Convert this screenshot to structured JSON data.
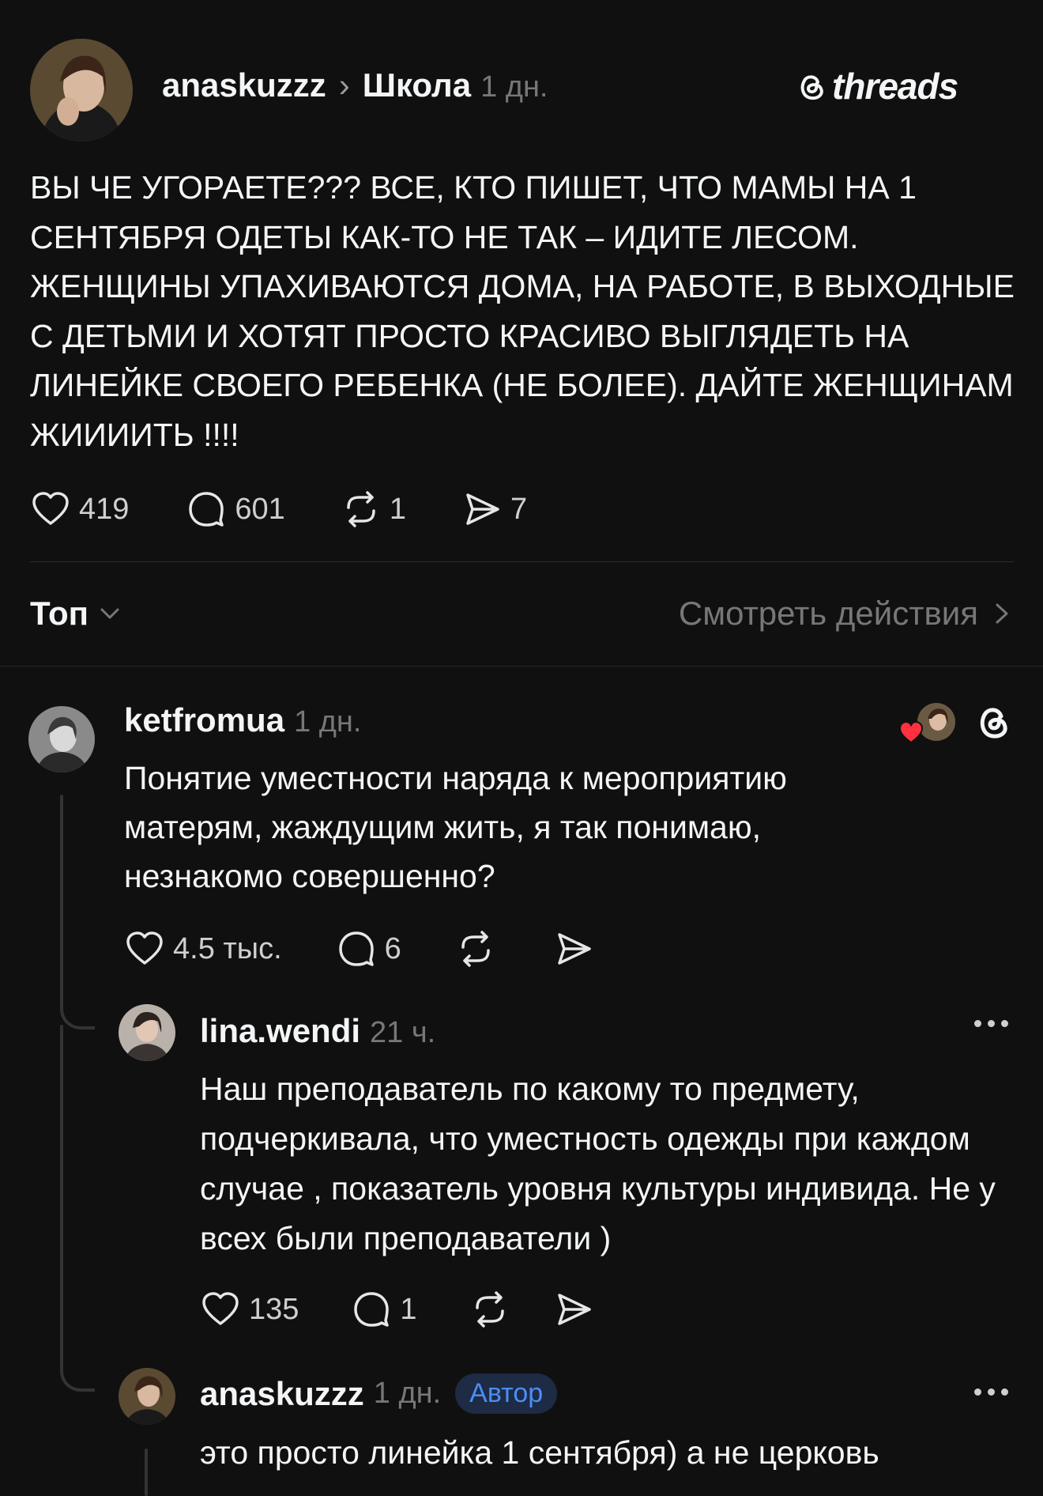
{
  "post": {
    "author": "anaskuzzz",
    "chevron": "›",
    "community": "Школа",
    "time": "1 дн.",
    "brand": "threads",
    "text": "ВЫ ЧЕ УГОРАЕТЕ??? ВСЕ, КТО ПИШЕТ, ЧТО МАМЫ НА 1 СЕНТЯБРЯ ОДЕТЫ КАК-ТО НЕ ТАК – ИДИТЕ ЛЕСОМ. ЖЕНЩИНЫ УПАХИВАЮТСЯ ДОМА, НА РАБОТЕ, В ВЫХОДНЫЕ С ДЕТЬМИ И ХОТЯТ ПРОСТО КРАСИВО ВЫГЛЯДЕТЬ НА ЛИНЕЙКЕ СВОЕГО РЕБЕНКА (НЕ БОЛЕЕ). ДАЙТЕ ЖЕНЩИНАМ ЖИИИИТЬ !!!!",
    "likes": "419",
    "replies": "601",
    "reposts": "1",
    "shares": "7"
  },
  "sort": {
    "label": "Топ",
    "activity_link": "Смотреть действия"
  },
  "comments": [
    {
      "author": "ketfromua",
      "time": "1 дн.",
      "text": "Понятие уместности наряда к мероприятию матерям, жаждущим жить, я так понимаю, незнакомо совершенно?",
      "likes": "4.5 тыс.",
      "replies": "6"
    },
    {
      "author": "lina.wendi",
      "time": "21 ч.",
      "text": "Наш преподаватель по какому то предмету, подчеркивала, что уместность одежды при каждом случае , показатель уровня культуры индивида. Не у всех были преподаватели )",
      "likes": "135",
      "replies": "1"
    },
    {
      "author": "anaskuzzz",
      "time": "1 дн.",
      "badge": "Автор",
      "text": "это просто линейка 1 сентября) а не церковь"
    }
  ],
  "icons": {
    "like": "heart-icon",
    "reply": "comment-icon",
    "repost": "repost-icon",
    "share": "send-icon",
    "more": "more-dots-icon",
    "brand": "threads-logo-icon"
  },
  "colors": {
    "background": "#101010",
    "text": "#f3f5f7",
    "muted": "#777777",
    "badge_bg": "#1d2b45",
    "badge_text": "#4c8df6",
    "heart_red": "#ff3040"
  }
}
